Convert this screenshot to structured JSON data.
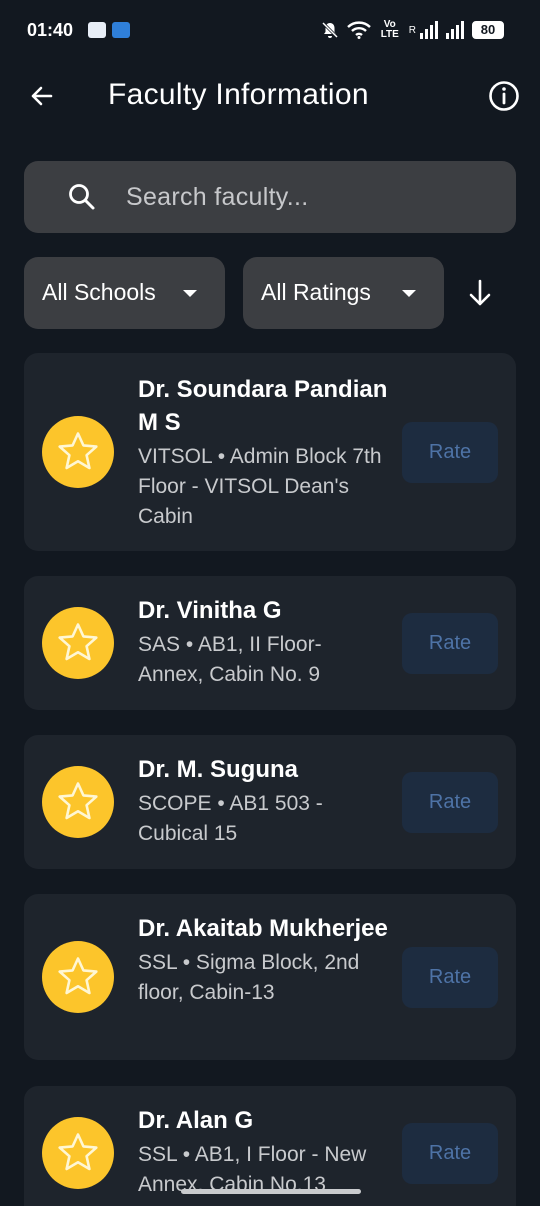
{
  "status_bar": {
    "time": "01:40",
    "volte": "Vo LTE",
    "roaming": "R",
    "battery": "80"
  },
  "header": {
    "title": "Faculty Information"
  },
  "search": {
    "placeholder": "Search faculty..."
  },
  "filters": {
    "school": "All Schools",
    "rating": "All Ratings"
  },
  "faculty": [
    {
      "name": "Dr. Soundara Pandian M S",
      "detail": "VITSOL • Admin Block 7th Floor - VITSOL Dean's Cabin",
      "rate_label": "Rate"
    },
    {
      "name": "Dr. Vinitha G",
      "detail": "SAS • AB1, II Floor- Annex, Cabin No. 9",
      "rate_label": "Rate"
    },
    {
      "name": "Dr. M. Suguna",
      "detail": "SCOPE • AB1 503 - Cubical 15",
      "rate_label": "Rate"
    },
    {
      "name": "Dr. Akaitab Mukherjee",
      "detail": "SSL • Sigma Block, 2nd floor, Cabin-13",
      "rate_label": "Rate"
    },
    {
      "name": "Dr. Alan G",
      "detail": "SSL • AB1, I Floor - New Annex, Cabin No.13",
      "rate_label": "Rate"
    }
  ],
  "colors": {
    "background": "#121820",
    "card": "#1e242c",
    "field": "#3c3e42",
    "avatar": "#fcc52b",
    "rate_button": "#1d2c40",
    "rate_text": "#4e73a6"
  },
  "icons": {
    "back": "arrow-left-icon",
    "info": "info-icon",
    "search": "search-icon",
    "sort": "arrow-down-icon",
    "avatar": "star-icon"
  }
}
